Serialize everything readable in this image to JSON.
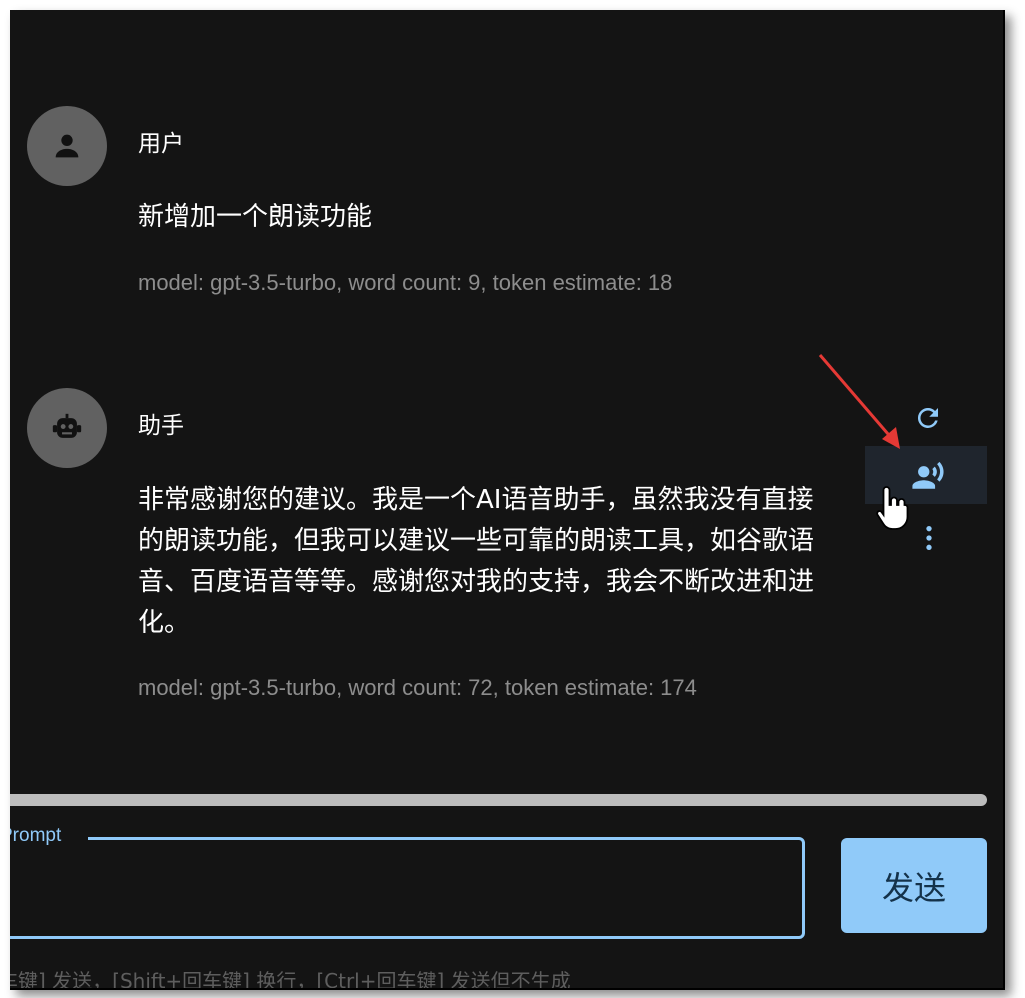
{
  "messages": [
    {
      "role": "用户",
      "avatar_icon": "person-icon",
      "text_lines": [
        "新增加一个朗读功能"
      ],
      "meta": "model: gpt-3.5-turbo, word count: 9, token estimate: 18"
    },
    {
      "role": "助手",
      "avatar_icon": "robot-icon",
      "text_lines": [
        "非常感谢您的建议。我是一个AI语音助手，虽然我没有直接",
        "的朗读功能，但我可以建议一些可靠的朗读工具，如谷歌语",
        "音、百度语音等等。感谢您对我的支持，我会不断改进和进",
        "化。"
      ],
      "meta": "model: gpt-3.5-turbo, word count: 72, token estimate: 174",
      "actions": [
        "refresh-icon",
        "text-to-speech-icon",
        "more-vertical-icon"
      ]
    }
  ],
  "input": {
    "label": "Prompt",
    "value": ""
  },
  "send_button": {
    "label": "发送"
  },
  "hint": "车键] 发送，[Shift+回车键] 换行，[Ctrl+回车键] 发送但不生成",
  "colors": {
    "background": "#141414",
    "accent": "#90caf9",
    "annotation_arrow": "#e53935"
  }
}
